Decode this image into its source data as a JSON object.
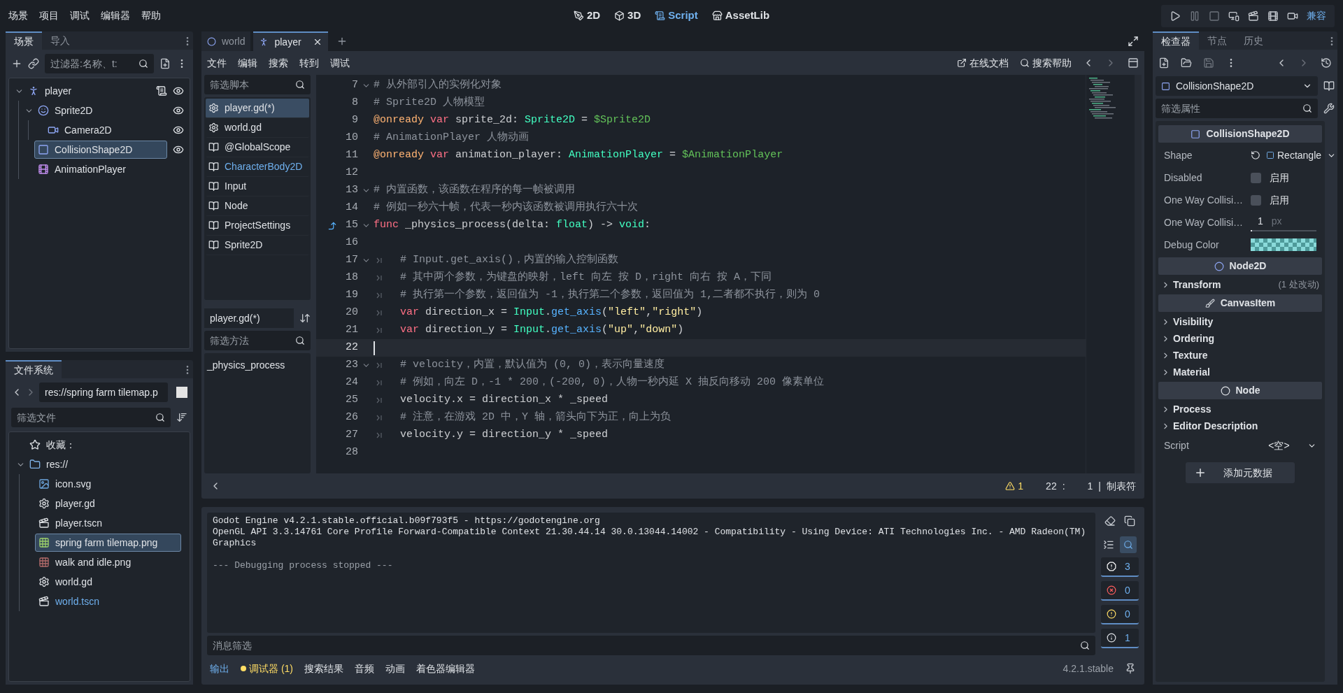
{
  "menu": [
    "场景",
    "项目",
    "调试",
    "编辑器",
    "帮助"
  ],
  "main_screens": [
    {
      "kind": "flat",
      "label": "2D",
      "selected": false
    },
    {
      "kind": "spatial",
      "label": "3D",
      "selected": false
    },
    {
      "kind": "script",
      "label": "Script",
      "selected": true
    },
    {
      "kind": "assetlib",
      "label": "AssetLib",
      "selected": false
    }
  ],
  "renderer": "兼容",
  "scene_dock": {
    "tabs": [
      {
        "label": "场景",
        "selected": true
      },
      {
        "label": "导入",
        "selected": false
      }
    ],
    "filter": {
      "placeholder": "过滤器:名称、t:"
    },
    "tree": [
      {
        "label": "player",
        "kind": "body",
        "has_script": true,
        "eye": true,
        "selected": false,
        "expanded": true,
        "children": [
          {
            "label": "Sprite2D",
            "kind": "sprite",
            "has_script": false,
            "eye": true,
            "selected": false,
            "expanded": true,
            "children": [
              {
                "label": "Camera2D",
                "kind": "camera",
                "has_script": false,
                "eye": true,
                "selected": false
              }
            ]
          },
          {
            "label": "CollisionShape2D",
            "kind": "collision",
            "has_script": false,
            "eye": true,
            "selected": true
          },
          {
            "label": "AnimationPlayer",
            "kind": "animation",
            "has_script": false,
            "eye": false,
            "selected": false
          }
        ]
      }
    ]
  },
  "filesystem": {
    "tabs": [
      {
        "label": "文件系统",
        "selected": true
      }
    ],
    "path": "res://spring farm tilemap.p",
    "filter": {
      "placeholder": "筛选文件"
    },
    "tree": [
      {
        "label": "收藏：",
        "kind": "favorites",
        "selected": false,
        "accent": false
      },
      {
        "label": "res://",
        "kind": "folder",
        "selected": false,
        "accent": false,
        "expanded": true,
        "children": [
          {
            "label": "icon.svg",
            "kind": "svg",
            "selected": false,
            "accent": false
          },
          {
            "label": "player.gd",
            "kind": "script",
            "selected": false,
            "accent": false
          },
          {
            "label": "player.tscn",
            "kind": "scene",
            "selected": false,
            "accent": false
          },
          {
            "label": "spring farm tilemap.png",
            "kind": "tileset",
            "selected": true,
            "accent": false
          },
          {
            "label": "walk and idle.png",
            "kind": "sprites",
            "selected": false,
            "accent": false
          },
          {
            "label": "world.gd",
            "kind": "script",
            "selected": false,
            "accent": false
          },
          {
            "label": "world.tscn",
            "kind": "scene",
            "selected": false,
            "accent": true
          }
        ]
      }
    ]
  },
  "editor_tabs": [
    {
      "label": "world",
      "kind": "scene",
      "selected": false
    },
    {
      "label": "player",
      "kind": "script",
      "selected": true
    }
  ],
  "script_menu": [
    "文件",
    "编辑",
    "搜索",
    "转到",
    "调试"
  ],
  "help_links": [
    "在线文档",
    "搜索帮助"
  ],
  "script_filter": {
    "placeholder": "筛选脚本"
  },
  "scripts": [
    {
      "label": "player.gd(*)",
      "kind": "script",
      "selected": true,
      "accent": false
    },
    {
      "label": "world.gd",
      "kind": "script",
      "selected": false,
      "accent": false
    },
    {
      "label": "@GlobalScope",
      "kind": "doc",
      "selected": false,
      "accent": false
    },
    {
      "label": "CharacterBody2D",
      "kind": "doc",
      "selected": false,
      "accent": true
    },
    {
      "label": "Input",
      "kind": "doc",
      "selected": false,
      "accent": false
    },
    {
      "label": "Node",
      "kind": "doc",
      "selected": false,
      "accent": false
    },
    {
      "label": "ProjectSettings",
      "kind": "doc",
      "selected": false,
      "accent": false
    },
    {
      "label": "Sprite2D",
      "kind": "doc",
      "selected": false,
      "accent": false
    }
  ],
  "current_script": "player.gd(*)",
  "method_filter": {
    "placeholder": "筛选方法"
  },
  "methods": [
    "_physics_process"
  ],
  "code": [
    {
      "number": "7",
      "fold": true,
      "indent": false,
      "current": false,
      "override": false,
      "tokens": [
        {
          "kind": "comment",
          "text": "# 从外部引入的实例化对象"
        }
      ]
    },
    {
      "number": "8",
      "fold": false,
      "indent": false,
      "current": false,
      "override": false,
      "tokens": [
        {
          "kind": "comment",
          "text": "# Sprite2D 人物模型"
        }
      ]
    },
    {
      "number": "9",
      "fold": false,
      "indent": false,
      "current": false,
      "override": false,
      "tokens": [
        {
          "kind": "annotation",
          "text": "@onready"
        },
        {
          "kind": "keyword",
          "text": " var"
        },
        {
          "kind": "plain",
          "text": " sprite_2d: "
        },
        {
          "kind": "type",
          "text": "Sprite2D"
        },
        {
          "kind": "plain",
          "text": " = "
        },
        {
          "kind": "nodepath",
          "text": "$Sprite2D"
        }
      ]
    },
    {
      "number": "10",
      "fold": false,
      "indent": false,
      "current": false,
      "override": false,
      "tokens": [
        {
          "kind": "comment",
          "text": "# AnimationPlayer 人物动画"
        }
      ]
    },
    {
      "number": "11",
      "fold": false,
      "indent": false,
      "current": false,
      "override": false,
      "tokens": [
        {
          "kind": "annotation",
          "text": "@onready"
        },
        {
          "kind": "keyword",
          "text": " var"
        },
        {
          "kind": "plain",
          "text": " animation_player: "
        },
        {
          "kind": "type",
          "text": "AnimationPlayer"
        },
        {
          "kind": "plain",
          "text": " = "
        },
        {
          "kind": "nodepath",
          "text": "$AnimationPlayer"
        }
      ]
    },
    {
      "number": "12",
      "fold": false,
      "indent": false,
      "current": false,
      "override": false
    },
    {
      "number": "13",
      "fold": true,
      "indent": false,
      "current": false,
      "override": false,
      "tokens": [
        {
          "kind": "comment",
          "text": "# 内置函数，该函数在程序的每一帧被调用"
        }
      ]
    },
    {
      "number": "14",
      "fold": false,
      "indent": false,
      "current": false,
      "override": false,
      "tokens": [
        {
          "kind": "comment",
          "text": "# 例如一秒六十帧，代表一秒内该函数被调用执行六十次"
        }
      ]
    },
    {
      "number": "15",
      "fold": true,
      "indent": false,
      "current": false,
      "override": true,
      "tokens": [
        {
          "kind": "keyword",
          "text": "func"
        },
        {
          "kind": "plain",
          "text": " _physics_process(delta: "
        },
        {
          "kind": "type",
          "text": "float"
        },
        {
          "kind": "plain",
          "text": ") -> "
        },
        {
          "kind": "type",
          "text": "void"
        },
        {
          "kind": "plain",
          "text": ":"
        }
      ]
    },
    {
      "number": "16",
      "fold": false,
      "indent": false,
      "current": false,
      "override": false
    },
    {
      "number": "17",
      "fold": true,
      "indent": true,
      "current": false,
      "override": false,
      "tokens": [
        {
          "kind": "comment",
          "text": "# Input.get_axis()，内置的输入控制函数"
        }
      ]
    },
    {
      "number": "18",
      "fold": false,
      "indent": true,
      "current": false,
      "override": false,
      "tokens": [
        {
          "kind": "comment",
          "text": "# 其中两个参数，为键盘的映射，left 向左 按 D，right 向右 按 A，下同"
        }
      ]
    },
    {
      "number": "19",
      "fold": false,
      "indent": true,
      "current": false,
      "override": false,
      "tokens": [
        {
          "kind": "comment",
          "text": "# 执行第一个参数，返回值为 -1，执行第二个参数，返回值为 1,二者都不执行，则为 0"
        }
      ]
    },
    {
      "number": "20",
      "fold": false,
      "indent": true,
      "current": false,
      "override": false,
      "tokens": [
        {
          "kind": "keyword",
          "text": "var"
        },
        {
          "kind": "plain",
          "text": " direction_x = "
        },
        {
          "kind": "type",
          "text": "Input"
        },
        {
          "kind": "plain",
          "text": "."
        },
        {
          "kind": "call",
          "text": "get_axis"
        },
        {
          "kind": "plain",
          "text": "("
        },
        {
          "kind": "string",
          "text": "\"left\""
        },
        {
          "kind": "plain",
          "text": ","
        },
        {
          "kind": "string",
          "text": "\"right\""
        },
        {
          "kind": "plain",
          "text": ")"
        }
      ]
    },
    {
      "number": "21",
      "fold": false,
      "indent": true,
      "current": false,
      "override": false,
      "tokens": [
        {
          "kind": "keyword",
          "text": "var"
        },
        {
          "kind": "plain",
          "text": " direction_y = "
        },
        {
          "kind": "type",
          "text": "Input"
        },
        {
          "kind": "plain",
          "text": "."
        },
        {
          "kind": "call",
          "text": "get_axis"
        },
        {
          "kind": "plain",
          "text": "("
        },
        {
          "kind": "string",
          "text": "\"up\""
        },
        {
          "kind": "plain",
          "text": ","
        },
        {
          "kind": "string",
          "text": "\"down\""
        },
        {
          "kind": "plain",
          "text": ")"
        }
      ]
    },
    {
      "number": "22",
      "fold": false,
      "indent": false,
      "current": true,
      "override": false
    },
    {
      "number": "23",
      "fold": true,
      "indent": true,
      "current": false,
      "override": false,
      "tokens": [
        {
          "kind": "comment",
          "text": "# velocity，内置，默认值为 (0, 0)，表示向量速度"
        }
      ]
    },
    {
      "number": "24",
      "fold": false,
      "indent": true,
      "current": false,
      "override": false,
      "tokens": [
        {
          "kind": "comment",
          "text": "# 例如，向左 D，-1 * 200，(-200, 0)，人物一秒内延 X 抽反向移动 200 像素单位"
        }
      ]
    },
    {
      "number": "25",
      "fold": false,
      "indent": true,
      "current": false,
      "override": false,
      "tokens": [
        {
          "kind": "plain",
          "text": "velocity.x = direction_x * _speed"
        }
      ]
    },
    {
      "number": "26",
      "fold": false,
      "indent": true,
      "current": false,
      "override": false,
      "tokens": [
        {
          "kind": "comment",
          "text": "# 注意，在游戏 2D 中，Y 轴，箭头向下为正，向上为负"
        }
      ]
    },
    {
      "number": "27",
      "fold": false,
      "indent": true,
      "current": false,
      "override": false,
      "tokens": [
        {
          "kind": "plain",
          "text": "velocity.y = direction_y * _speed"
        }
      ]
    },
    {
      "number": "28",
      "fold": false,
      "indent": false,
      "current": false,
      "override": false
    }
  ],
  "status": {
    "warnings": "1",
    "line": "22",
    "line_sep": ":",
    "column": "1",
    "sep": "|",
    "indent": "制表符"
  },
  "output": {
    "lines": [
      {
        "kind": "info",
        "text": "Godot Engine v4.2.1.stable.official.b09f793f5 - https://godotengine.org"
      },
      {
        "kind": "info",
        "text": "OpenGL API 3.3.14761 Core Profile Forward-Compatible Context 21.30.44.14 30.0.13044.14002 - Compatibility - Using Device: ATI Technologies Inc. - AMD Radeon(TM) Graphics"
      },
      {
        "kind": "muted",
        "text": "--- Debugging process stopped ---"
      }
    ],
    "filter": {
      "placeholder": "消息筛选"
    },
    "search_on": true,
    "counters": [
      {
        "kind": "log",
        "count": "3",
        "on": true
      },
      {
        "kind": "error",
        "count": "0",
        "on": true
      },
      {
        "kind": "warning",
        "count": "0",
        "on": true
      },
      {
        "kind": "editor",
        "count": "1",
        "on": true
      }
    ]
  },
  "bottom_tabs": [
    {
      "label": "输出",
      "selected": true,
      "alert": false
    },
    {
      "label": "调试器 (1)",
      "selected": false,
      "alert": true
    },
    {
      "label": "搜索结果",
      "selected": false,
      "alert": false
    },
    {
      "label": "音频",
      "selected": false,
      "alert": false
    },
    {
      "label": "动画",
      "selected": false,
      "alert": false
    },
    {
      "label": "着色器编辑器",
      "selected": false,
      "alert": false
    }
  ],
  "version": "4.2.1.stable",
  "inspector": {
    "tabs": [
      {
        "label": "检查器",
        "selected": true
      },
      {
        "label": "节点",
        "selected": false
      },
      {
        "label": "历史",
        "selected": false
      }
    ],
    "object": "CollisionShape2D",
    "filter": {
      "placeholder": "筛选属性"
    },
    "rows": [
      {
        "kind": "category",
        "label": "CollisionShape2D"
      },
      {
        "kind": "enum",
        "label": "Shape",
        "value": "Rectangle"
      },
      {
        "kind": "checkbox",
        "label": "Disabled",
        "checked": false,
        "text": "启用"
      },
      {
        "kind": "checkbox",
        "label": "One Way Collisi…",
        "checked": false,
        "text": "启用"
      },
      {
        "kind": "slider",
        "label": "One Way Collisi…",
        "value": "1",
        "unit": "px",
        "level": 0.02
      },
      {
        "kind": "swatch",
        "label": "Debug Color"
      },
      {
        "kind": "category",
        "label": "Node2D"
      },
      {
        "kind": "group",
        "label": "Transform",
        "note": "(1 处改动)"
      },
      {
        "kind": "category",
        "label": "CanvasItem"
      },
      {
        "kind": "group",
        "label": "Visibility"
      },
      {
        "kind": "group",
        "label": "Ordering"
      },
      {
        "kind": "group",
        "label": "Texture"
      },
      {
        "kind": "group",
        "label": "Material"
      },
      {
        "kind": "category",
        "label": "Node"
      },
      {
        "kind": "group",
        "label": "Process"
      },
      {
        "kind": "group",
        "label": "Editor Description"
      },
      {
        "kind": "resource",
        "label": "Script",
        "value": "<空>"
      }
    ],
    "add_button": "添加元数据"
  }
}
